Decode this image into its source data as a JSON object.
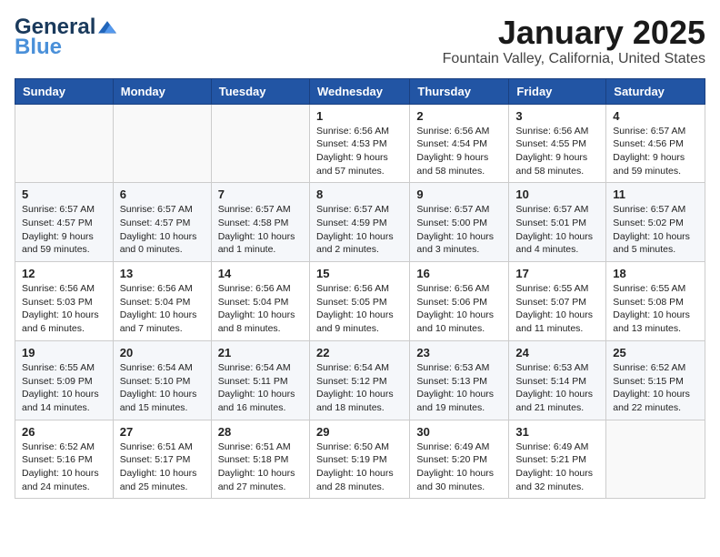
{
  "header": {
    "logo_general": "General",
    "logo_blue": "Blue",
    "month_title": "January 2025",
    "location": "Fountain Valley, California, United States"
  },
  "weekdays": [
    "Sunday",
    "Monday",
    "Tuesday",
    "Wednesday",
    "Thursday",
    "Friday",
    "Saturday"
  ],
  "weeks": [
    [
      {
        "day": "",
        "sunrise": "",
        "sunset": "",
        "daylight": ""
      },
      {
        "day": "",
        "sunrise": "",
        "sunset": "",
        "daylight": ""
      },
      {
        "day": "",
        "sunrise": "",
        "sunset": "",
        "daylight": ""
      },
      {
        "day": "1",
        "sunrise": "Sunrise: 6:56 AM",
        "sunset": "Sunset: 4:53 PM",
        "daylight": "Daylight: 9 hours and 57 minutes."
      },
      {
        "day": "2",
        "sunrise": "Sunrise: 6:56 AM",
        "sunset": "Sunset: 4:54 PM",
        "daylight": "Daylight: 9 hours and 58 minutes."
      },
      {
        "day": "3",
        "sunrise": "Sunrise: 6:56 AM",
        "sunset": "Sunset: 4:55 PM",
        "daylight": "Daylight: 9 hours and 58 minutes."
      },
      {
        "day": "4",
        "sunrise": "Sunrise: 6:57 AM",
        "sunset": "Sunset: 4:56 PM",
        "daylight": "Daylight: 9 hours and 59 minutes."
      }
    ],
    [
      {
        "day": "5",
        "sunrise": "Sunrise: 6:57 AM",
        "sunset": "Sunset: 4:57 PM",
        "daylight": "Daylight: 9 hours and 59 minutes."
      },
      {
        "day": "6",
        "sunrise": "Sunrise: 6:57 AM",
        "sunset": "Sunset: 4:57 PM",
        "daylight": "Daylight: 10 hours and 0 minutes."
      },
      {
        "day": "7",
        "sunrise": "Sunrise: 6:57 AM",
        "sunset": "Sunset: 4:58 PM",
        "daylight": "Daylight: 10 hours and 1 minute."
      },
      {
        "day": "8",
        "sunrise": "Sunrise: 6:57 AM",
        "sunset": "Sunset: 4:59 PM",
        "daylight": "Daylight: 10 hours and 2 minutes."
      },
      {
        "day": "9",
        "sunrise": "Sunrise: 6:57 AM",
        "sunset": "Sunset: 5:00 PM",
        "daylight": "Daylight: 10 hours and 3 minutes."
      },
      {
        "day": "10",
        "sunrise": "Sunrise: 6:57 AM",
        "sunset": "Sunset: 5:01 PM",
        "daylight": "Daylight: 10 hours and 4 minutes."
      },
      {
        "day": "11",
        "sunrise": "Sunrise: 6:57 AM",
        "sunset": "Sunset: 5:02 PM",
        "daylight": "Daylight: 10 hours and 5 minutes."
      }
    ],
    [
      {
        "day": "12",
        "sunrise": "Sunrise: 6:56 AM",
        "sunset": "Sunset: 5:03 PM",
        "daylight": "Daylight: 10 hours and 6 minutes."
      },
      {
        "day": "13",
        "sunrise": "Sunrise: 6:56 AM",
        "sunset": "Sunset: 5:04 PM",
        "daylight": "Daylight: 10 hours and 7 minutes."
      },
      {
        "day": "14",
        "sunrise": "Sunrise: 6:56 AM",
        "sunset": "Sunset: 5:04 PM",
        "daylight": "Daylight: 10 hours and 8 minutes."
      },
      {
        "day": "15",
        "sunrise": "Sunrise: 6:56 AM",
        "sunset": "Sunset: 5:05 PM",
        "daylight": "Daylight: 10 hours and 9 minutes."
      },
      {
        "day": "16",
        "sunrise": "Sunrise: 6:56 AM",
        "sunset": "Sunset: 5:06 PM",
        "daylight": "Daylight: 10 hours and 10 minutes."
      },
      {
        "day": "17",
        "sunrise": "Sunrise: 6:55 AM",
        "sunset": "Sunset: 5:07 PM",
        "daylight": "Daylight: 10 hours and 11 minutes."
      },
      {
        "day": "18",
        "sunrise": "Sunrise: 6:55 AM",
        "sunset": "Sunset: 5:08 PM",
        "daylight": "Daylight: 10 hours and 13 minutes."
      }
    ],
    [
      {
        "day": "19",
        "sunrise": "Sunrise: 6:55 AM",
        "sunset": "Sunset: 5:09 PM",
        "daylight": "Daylight: 10 hours and 14 minutes."
      },
      {
        "day": "20",
        "sunrise": "Sunrise: 6:54 AM",
        "sunset": "Sunset: 5:10 PM",
        "daylight": "Daylight: 10 hours and 15 minutes."
      },
      {
        "day": "21",
        "sunrise": "Sunrise: 6:54 AM",
        "sunset": "Sunset: 5:11 PM",
        "daylight": "Daylight: 10 hours and 16 minutes."
      },
      {
        "day": "22",
        "sunrise": "Sunrise: 6:54 AM",
        "sunset": "Sunset: 5:12 PM",
        "daylight": "Daylight: 10 hours and 18 minutes."
      },
      {
        "day": "23",
        "sunrise": "Sunrise: 6:53 AM",
        "sunset": "Sunset: 5:13 PM",
        "daylight": "Daylight: 10 hours and 19 minutes."
      },
      {
        "day": "24",
        "sunrise": "Sunrise: 6:53 AM",
        "sunset": "Sunset: 5:14 PM",
        "daylight": "Daylight: 10 hours and 21 minutes."
      },
      {
        "day": "25",
        "sunrise": "Sunrise: 6:52 AM",
        "sunset": "Sunset: 5:15 PM",
        "daylight": "Daylight: 10 hours and 22 minutes."
      }
    ],
    [
      {
        "day": "26",
        "sunrise": "Sunrise: 6:52 AM",
        "sunset": "Sunset: 5:16 PM",
        "daylight": "Daylight: 10 hours and 24 minutes."
      },
      {
        "day": "27",
        "sunrise": "Sunrise: 6:51 AM",
        "sunset": "Sunset: 5:17 PM",
        "daylight": "Daylight: 10 hours and 25 minutes."
      },
      {
        "day": "28",
        "sunrise": "Sunrise: 6:51 AM",
        "sunset": "Sunset: 5:18 PM",
        "daylight": "Daylight: 10 hours and 27 minutes."
      },
      {
        "day": "29",
        "sunrise": "Sunrise: 6:50 AM",
        "sunset": "Sunset: 5:19 PM",
        "daylight": "Daylight: 10 hours and 28 minutes."
      },
      {
        "day": "30",
        "sunrise": "Sunrise: 6:49 AM",
        "sunset": "Sunset: 5:20 PM",
        "daylight": "Daylight: 10 hours and 30 minutes."
      },
      {
        "day": "31",
        "sunrise": "Sunrise: 6:49 AM",
        "sunset": "Sunset: 5:21 PM",
        "daylight": "Daylight: 10 hours and 32 minutes."
      },
      {
        "day": "",
        "sunrise": "",
        "sunset": "",
        "daylight": ""
      }
    ]
  ]
}
